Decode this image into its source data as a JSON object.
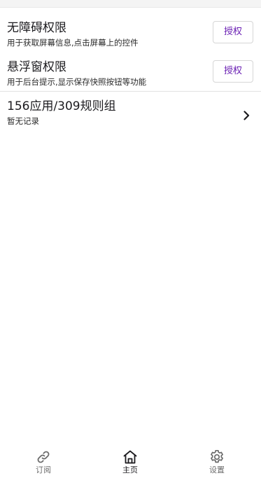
{
  "permissions": [
    {
      "title": "无障碍权限",
      "subtitle": "用于获取屏幕信息,点击屏幕上的控件",
      "button_label": "授权"
    },
    {
      "title": "悬浮窗权限",
      "subtitle": "用于后台提示,显示保存快照按钮等功能",
      "button_label": "授权"
    }
  ],
  "summary": {
    "title": "156应用/309规则组",
    "subtitle": "暂无记录",
    "chevron_icon": "chevron-right-icon"
  },
  "nav": {
    "items": [
      {
        "label": "订阅",
        "icon": "link-icon",
        "selected": false
      },
      {
        "label": "主页",
        "icon": "home-icon",
        "selected": true
      },
      {
        "label": "设置",
        "icon": "gear-icon",
        "selected": false
      }
    ]
  },
  "colors": {
    "accent": "#6a1fb3",
    "text": "#1c1b1f",
    "nav_inactive": "#6b6b6b",
    "divider": "#e2e2e2"
  }
}
